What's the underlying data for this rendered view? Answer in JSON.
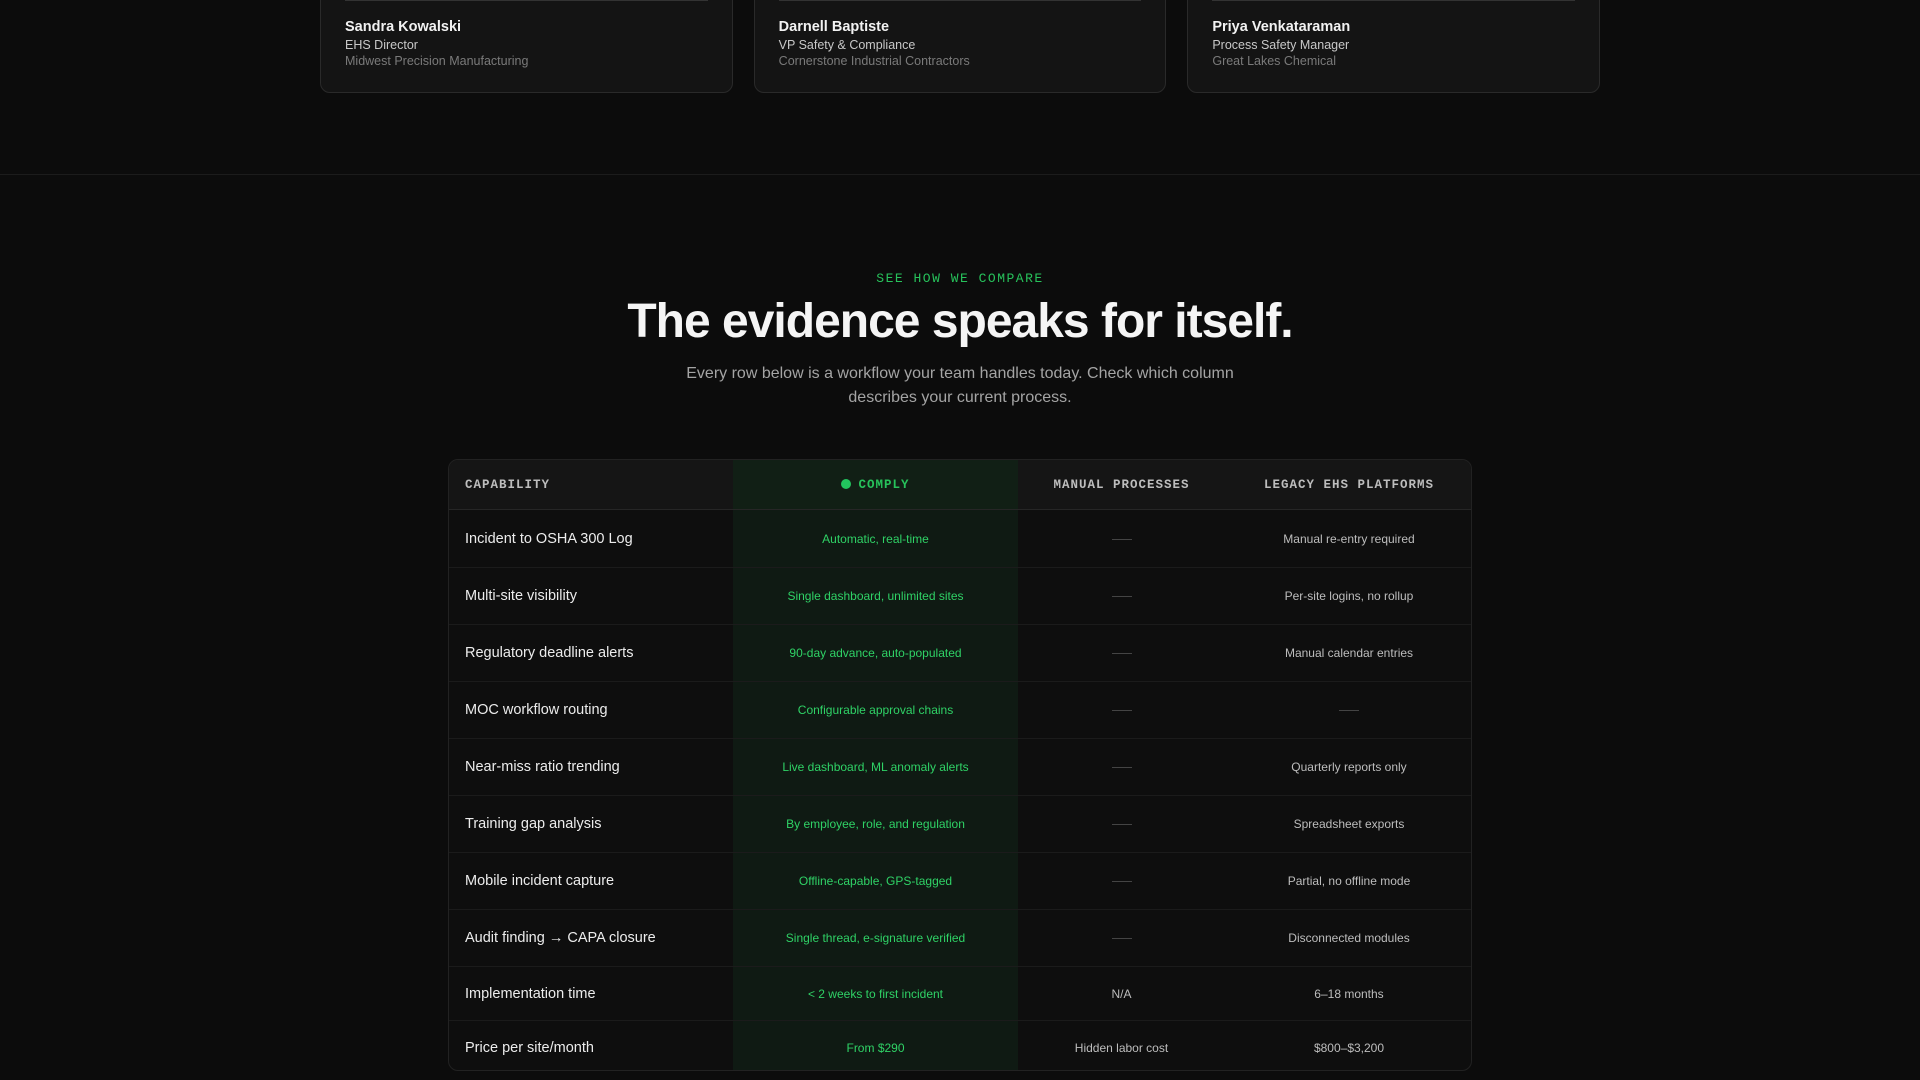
{
  "testimonials": [
    {
      "name": "Sandra Kowalski",
      "role": "EHS Director",
      "company": "Midwest Precision Manufacturing"
    },
    {
      "name": "Darnell Baptiste",
      "role": "VP Safety & Compliance",
      "company": "Cornerstone Industrial Contractors"
    },
    {
      "name": "Priya Venkataraman",
      "role": "Process Safety Manager",
      "company": "Great Lakes Chemical"
    }
  ],
  "compare": {
    "eyebrow": "SEE HOW WE COMPARE",
    "headline": "The evidence speaks for itself.",
    "subhead": "Every row below is a workflow your team handles today. Check which column describes your current process.",
    "headers": {
      "capability": "CAPABILITY",
      "comply": "COMPLY",
      "manual": "MANUAL PROCESSES",
      "legacy": "LEGACY EHS PLATFORMS"
    },
    "rows": [
      {
        "capability": "Incident to OSHA 300 Log",
        "comply": "Automatic, real-time",
        "manual": "",
        "legacy": "Manual re-entry required"
      },
      {
        "capability": "Multi-site visibility",
        "comply": "Single dashboard, unlimited sites",
        "manual": "",
        "legacy": "Per-site logins, no rollup"
      },
      {
        "capability": "Regulatory deadline alerts",
        "comply": "90-day advance, auto-populated",
        "manual": "",
        "legacy": "Manual calendar entries"
      },
      {
        "capability": "MOC workflow routing",
        "comply": "Configurable approval chains",
        "manual": "",
        "legacy": ""
      },
      {
        "capability": "Near-miss ratio trending",
        "comply": "Live dashboard, ML anomaly alerts",
        "manual": "",
        "legacy": "Quarterly reports only"
      },
      {
        "capability": "Training gap analysis",
        "comply": "By employee, role, and regulation",
        "manual": "",
        "legacy": "Spreadsheet exports"
      },
      {
        "capability": "Mobile incident capture",
        "comply": "Offline-capable, GPS-tagged",
        "manual": "",
        "legacy": "Partial, no offline mode"
      },
      {
        "capability": "Audit finding → CAPA closure",
        "comply": "Single thread, e-signature verified",
        "manual": "",
        "legacy": "Disconnected modules"
      },
      {
        "capability": "Implementation time",
        "comply": "< 2 weeks to first incident",
        "manual": "N/A",
        "legacy": "6–18 months"
      },
      {
        "capability": "Price per site/month",
        "comply": "From $290",
        "manual": "Hidden labor cost",
        "legacy": "$800–$3,200"
      }
    ]
  }
}
